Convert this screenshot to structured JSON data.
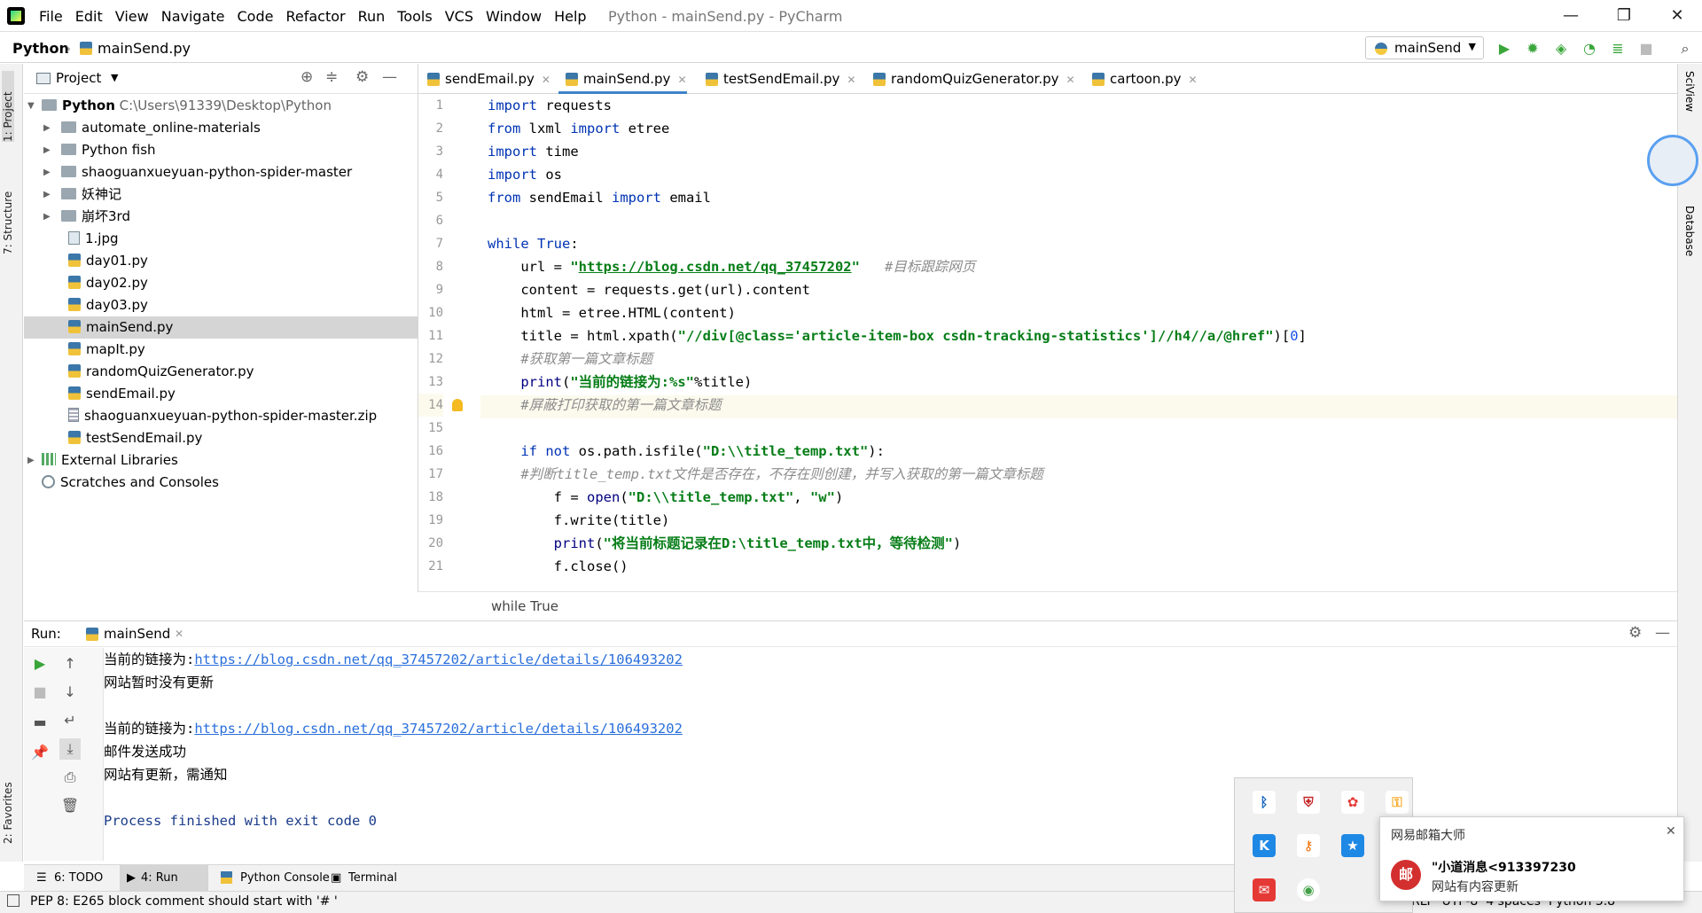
{
  "menubar": {
    "items": [
      "File",
      "Edit",
      "View",
      "Navigate",
      "Code",
      "Refactor",
      "Run",
      "Tools",
      "VCS",
      "Window",
      "Help"
    ],
    "title": "Python - mainSend.py - PyCharm"
  },
  "navbar": {
    "project": "Python",
    "file": "mainSend.py",
    "run_config": "mainSend"
  },
  "left_strip": {
    "project": "1: Project",
    "structure": "7: Structure",
    "favorites": "2: Favorites"
  },
  "right_strip": {
    "sciview": "SciView",
    "database": "Database"
  },
  "project_panel": {
    "title": "Project",
    "root": {
      "name": "Python",
      "path": "C:\\Users\\91339\\Desktop\\Python"
    },
    "folders": [
      "automate_online-materials",
      "Python fish",
      "shaoguanxueyuan-python-spider-master",
      "妖神记",
      "崩坏3rd"
    ],
    "files": [
      "1.jpg",
      "day01.py",
      "day02.py",
      "day03.py",
      "mainSend.py",
      "mapIt.py",
      "randomQuizGenerator.py",
      "sendEmail.py",
      "shaoguanxueyuan-python-spider-master.zip",
      "testSendEmail.py"
    ],
    "external": "External Libraries",
    "scratches": "Scratches and Consoles",
    "selected": "mainSend.py"
  },
  "tabs": [
    "sendEmail.py",
    "mainSend.py",
    "testSendEmail.py",
    "randomQuizGenerator.py",
    "cartoon.py"
  ],
  "active_tab": "mainSend.py",
  "editor": {
    "line_numbers": [
      "1",
      "2",
      "3",
      "4",
      "5",
      "6",
      "7",
      "8",
      "9",
      "10",
      "11",
      "12",
      "13",
      "14",
      "15",
      "16",
      "17",
      "18",
      "19",
      "20",
      "21"
    ],
    "current_line": "14",
    "code": {
      "l1a": "import",
      "l1b": " requests",
      "l2a": "from",
      "l2b": " lxml ",
      "l2c": "import",
      "l2d": " etree",
      "l3a": "import",
      "l3b": " time",
      "l4a": "import",
      "l4b": " os",
      "l5a": "from",
      "l5b": " sendEmail ",
      "l5c": "import",
      "l5d": " email",
      "l7a": "while",
      "l7b": " True",
      "l7c": ":",
      "l8a": "    url = ",
      "l8q1": "\"",
      "l8url": "https://blog.csdn.net/qq_37457202",
      "l8q2": "\"",
      "l8c": "   #目标跟踪网页",
      "l9": "    content = requests.get(url).content",
      "l10": "    html = etree.HTML(content)",
      "l11a": "    title = html.xpath(",
      "l11s": "\"//div[@class='article-item-box csdn-tracking-statistics']//h4//a/@href\"",
      "l11b": ")[",
      "l11n": "0",
      "l11c": "]",
      "l12": "    #获取第一篇文章标题",
      "l13a": "    ",
      "l13p": "print",
      "l13b": "(",
      "l13s": "\"当前的链接为:%s\"",
      "l13c": "%title)",
      "l14": "    #屏蔽打印获取的第一篇文章标题",
      "l16a": "    ",
      "l16k1": "if not",
      "l16b": " os.path.isfile(",
      "l16s": "\"D:\\\\title_temp.txt\"",
      "l16c": "):",
      "l17": "    #判断title_temp.txt文件是否存在，不存在则创建，并写入获取的第一篇文章标题",
      "l18a": "        f = ",
      "l18p": "open",
      "l18b": "(",
      "l18s1": "\"D:\\\\title_temp.txt\"",
      "l18c": ", ",
      "l18s2": "\"w\"",
      "l18d": ")",
      "l19": "        f.write(title)",
      "l20a": "        ",
      "l20p": "print",
      "l20b": "(",
      "l20s": "\"将当前标题记录在D:\\title_temp.txt中，等待检测\"",
      "l20c": ")",
      "l21": "        f.close()"
    },
    "breadcrumb": "while True"
  },
  "run_panel": {
    "label": "Run:",
    "tab": "mainSend",
    "output": {
      "o1a": "当前的链接为:",
      "o1b": "https://blog.csdn.net/qq_37457202/article/details/106493202",
      "o2": "网站暂时没有更新",
      "o4a": "当前的链接为:",
      "o4b": "https://blog.csdn.net/qq_37457202/article/details/106493202",
      "o5": "邮件发送成功",
      "o6": "网站有更新，需通知",
      "o8": "Process finished with exit code 0"
    }
  },
  "bottom_tabs": {
    "todo": "6: TODO",
    "run": "4: Run",
    "console": "Python Console",
    "terminal": "Terminal"
  },
  "status": {
    "message": "PEP 8: E265 block comment should start with '# '",
    "right": "RLF  UTF-8  4 spaces  Python 3.8"
  },
  "notification": {
    "app": "网易邮箱大师",
    "sender": "\"小道消息<913397230",
    "body": "网站有内容更新",
    "icon_char": "邮"
  }
}
